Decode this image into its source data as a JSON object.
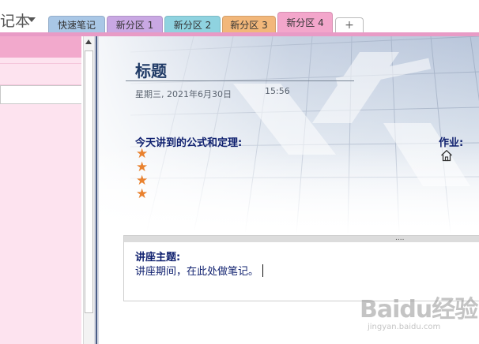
{
  "app": {
    "notebook_title": "记本"
  },
  "tabs": [
    {
      "label": "快速笔记",
      "color": "#a9c7e6"
    },
    {
      "label": "新分区 1",
      "color": "#c9a8e3"
    },
    {
      "label": "新分区 2",
      "color": "#8fd3e0"
    },
    {
      "label": "新分区 3",
      "color": "#f2b77a"
    },
    {
      "label": "新分区 4",
      "color": "#f3a6cb",
      "active": true
    }
  ],
  "add_tab_label": "+",
  "page": {
    "title": "标题",
    "date": "星期三, 2021年6月30日",
    "time": "15:56",
    "formula_label": "今天讲到的公式和定理:",
    "stars": [
      "★",
      "★",
      "★",
      "★"
    ],
    "homework_label": "作业:",
    "note": {
      "handle_dots": "....",
      "topic_label": "讲座主题:",
      "body_text": "讲座期间，在此处做笔记。"
    }
  },
  "watermark": {
    "main": "Baidu经验",
    "sub": "jingyan.baidu.com"
  },
  "colors": {
    "section_accent": "#e89bc6",
    "page_list_bg": "#fde3ef",
    "heading_navy": "#0e1f6e",
    "star_orange": "#e9822f"
  },
  "icons": {
    "homework": "home-icon",
    "notebook_dropdown": "chevron-down-icon",
    "scroll_up": "scroll-up-arrow-icon"
  }
}
